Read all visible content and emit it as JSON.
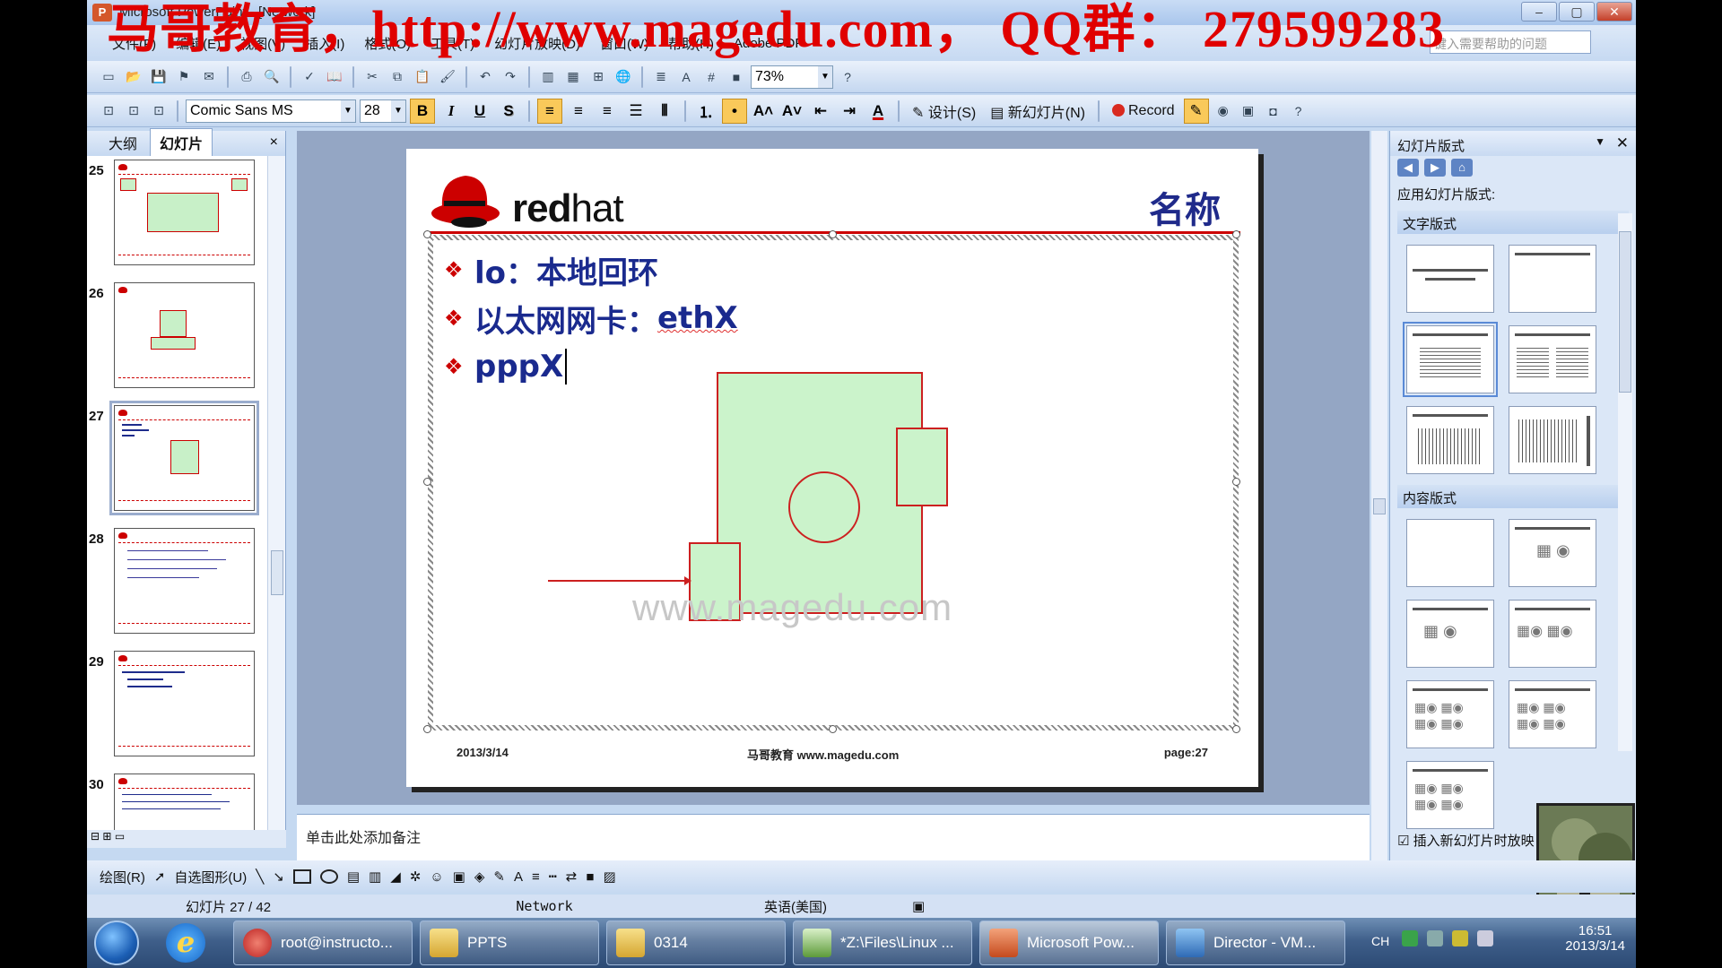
{
  "window": {
    "title": "Microsoft PowerPoint - [Network]",
    "watermark": "马哥教育，http://www.magedu.com，  QQ群：  279599283"
  },
  "menu": {
    "items": [
      "文件(F)",
      "编辑(E)",
      "视图(V)",
      "插入(I)",
      "格式(O)",
      "工具(T)",
      "幻灯片放映(D)",
      "窗口(W)",
      "帮助(H)",
      "Adobe PDF"
    ],
    "help_placeholder": "键入需要帮助的问题"
  },
  "toolbar": {
    "zoom": "73%",
    "font": "Comic Sans MS",
    "font_size": "28",
    "design_label": "设计(S)",
    "new_slide_label": "新幻灯片(N)",
    "record_label": "Record"
  },
  "left_panel": {
    "tab_outline": "大纲",
    "tab_slides": "幻灯片",
    "close": "×",
    "slide_numbers": [
      "25",
      "26",
      "27",
      "28",
      "29",
      "30"
    ]
  },
  "slide": {
    "logo_text_bold": "red",
    "logo_text": "hat",
    "title": "名称",
    "bullets": [
      {
        "text": "lo：本地回环",
        "squiggle": ""
      },
      {
        "text": "以太网网卡：",
        "squiggle": "ethX"
      },
      {
        "text": "pppX",
        "squiggle": ""
      }
    ],
    "watermark": "www.magedu.com",
    "footer_date": "2013/3/14",
    "footer_center": "马哥教育 www.magedu.com",
    "footer_page": "page:27"
  },
  "notes": {
    "placeholder": "单击此处添加备注"
  },
  "task_pane": {
    "title": "幻灯片版式",
    "apply_label": "应用幻灯片版式:",
    "section_text": "文字版式",
    "section_content": "内容版式",
    "checkbox_label": "插入新幻灯片时放映"
  },
  "draw_toolbar": {
    "draw_label": "绘图(R)",
    "autoshape_label": "自选图形(U)"
  },
  "status": {
    "slide_counter": "幻灯片 27 / 42",
    "design_name": "Network",
    "language": "英语(美国)"
  },
  "taskbar": {
    "tasks": [
      "root@instructo...",
      "PPTS",
      "0314",
      "*Z:\\Files\\Linux ...",
      "Microsoft Pow...",
      "Director - VM..."
    ],
    "ime": "CH",
    "time": "16:51",
    "date": "2013/3/14"
  },
  "colors": {
    "accent_red": "#cc0000",
    "slide_text": "#1a2a8e",
    "box_fill": "#cbf3cb"
  }
}
